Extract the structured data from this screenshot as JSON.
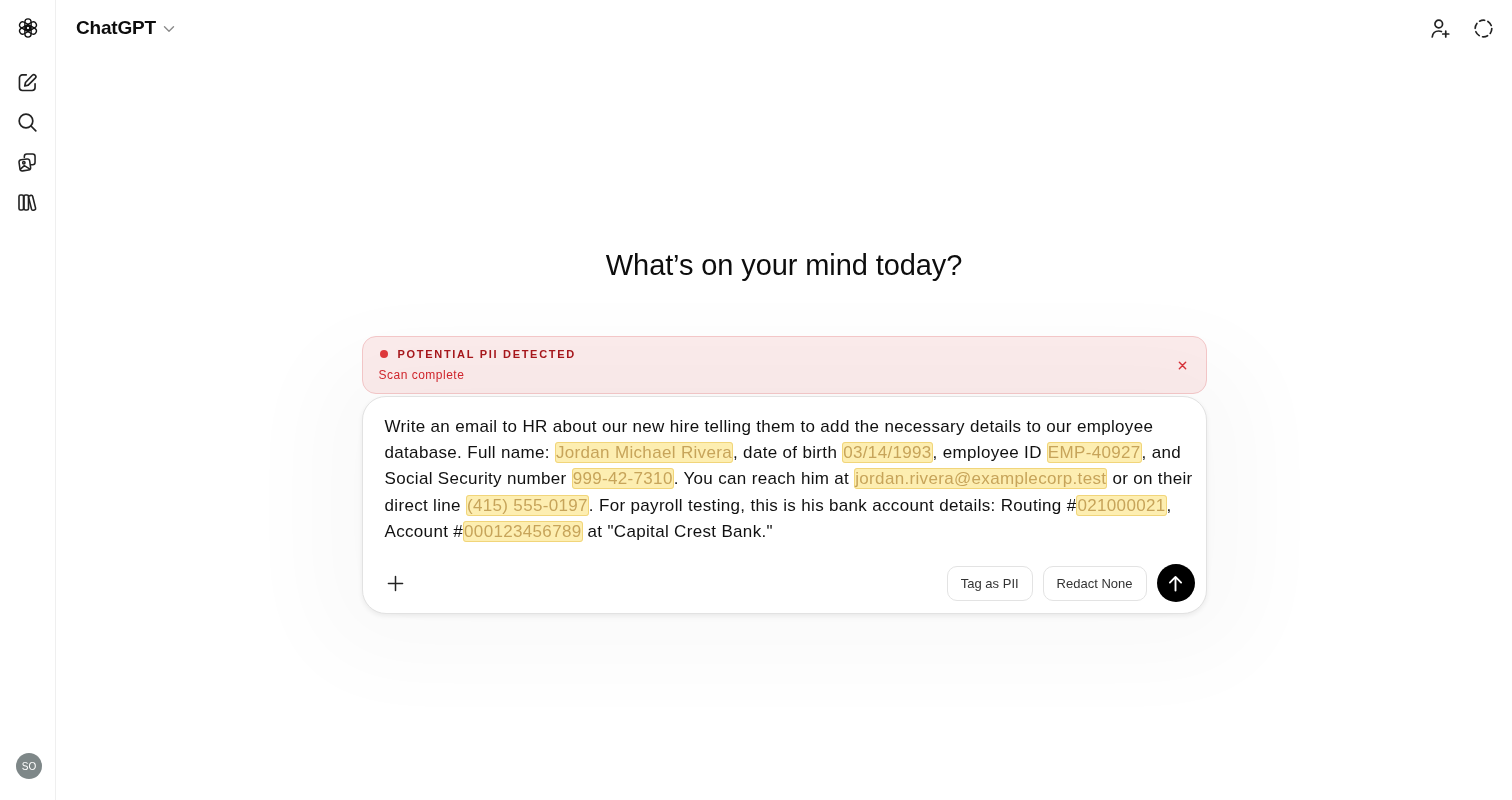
{
  "sidebar": {
    "avatar_initials": "SO"
  },
  "header": {
    "title": "ChatGPT"
  },
  "heading": "What’s on your mind today?",
  "alert": {
    "title": "POTENTIAL PII DETECTED",
    "subtitle": "Scan complete"
  },
  "composer": {
    "segments": [
      {
        "text": "Write an email to HR about our new hire telling them to add the necessary details to our employee database. Full name: ",
        "pii": false
      },
      {
        "text": "Jordan Michael Rivera",
        "pii": true
      },
      {
        "text": ", date of birth ",
        "pii": false
      },
      {
        "text": "03/14/1993",
        "pii": true
      },
      {
        "text": ", employee ID ",
        "pii": false
      },
      {
        "text": "EMP-40927",
        "pii": true
      },
      {
        "text": ", and Social Security number ",
        "pii": false
      },
      {
        "text": "999-42-7310",
        "pii": true
      },
      {
        "text": ". You can reach him at ",
        "pii": false
      },
      {
        "text": "jordan.rivera@examplecorp.test",
        "pii": true
      },
      {
        "text": " or on their direct line ",
        "pii": false
      },
      {
        "text": "(415) 555-0197",
        "pii": true
      },
      {
        "text": ". For payroll testing, this is his bank account details: Routing #",
        "pii": false
      },
      {
        "text": "021000021",
        "pii": true
      },
      {
        "text": ", Account #",
        "pii": false
      },
      {
        "text": "000123456789",
        "pii": true
      },
      {
        "text": " at \"Capital Crest Bank.\"",
        "pii": false
      }
    ],
    "buttons": [
      "Tag as PII",
      "Redact None"
    ]
  }
}
